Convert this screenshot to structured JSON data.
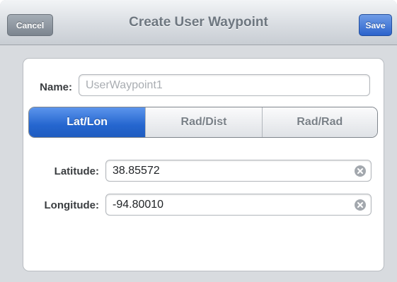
{
  "navbar": {
    "title": "Create User Waypoint",
    "cancel_label": "Cancel",
    "save_label": "Save"
  },
  "name_field": {
    "label": "Name:",
    "placeholder": "UserWaypoint1",
    "value": ""
  },
  "mode_selector": {
    "segments": [
      {
        "label": "Lat/Lon",
        "selected": true
      },
      {
        "label": "Rad/Dist",
        "selected": false
      },
      {
        "label": "Rad/Rad",
        "selected": false
      }
    ]
  },
  "latitude": {
    "label": "Latitude:",
    "value": "38.85572"
  },
  "longitude": {
    "label": "Longitude:",
    "value": "-94.80010"
  },
  "colors": {
    "accent": "#2566cf",
    "navbar": "#d9dde2",
    "background": "#d8dbdf"
  }
}
